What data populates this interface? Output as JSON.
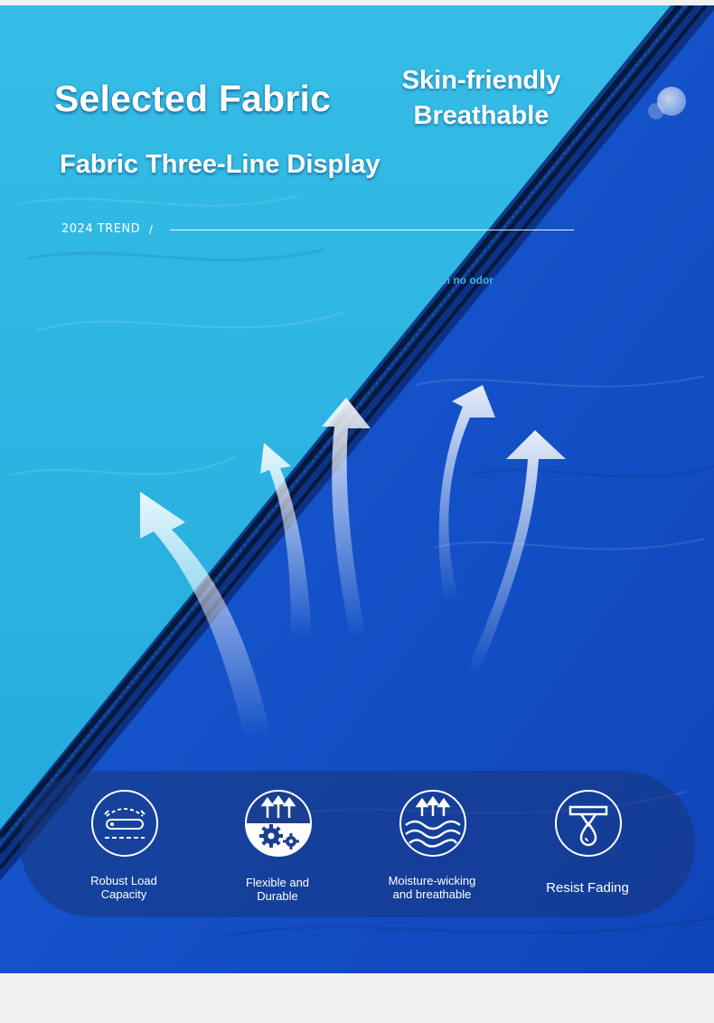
{
  "hero": {
    "title": "Selected Fabric",
    "tagline_line1": "Skin-friendly",
    "tagline_line2": "Breathable",
    "subtitle": "Fabric Three-Line Display",
    "trend": "2024 TREND",
    "trend_separator": "/",
    "description": "comfortable with no odor"
  },
  "features": [
    {
      "label_line1": "Robust Load",
      "label_line2": "Capacity",
      "icon": "rolled-hammock-icon"
    },
    {
      "label_line1": "Flexible and",
      "label_line2": "Durable",
      "icon": "gears-arrows-icon"
    },
    {
      "label_line1": "Moisture-wicking",
      "label_line2": "and breathable",
      "icon": "waves-arrows-icon"
    },
    {
      "label_line1": "Resist Fading",
      "label_line2": "",
      "icon": "drop-shield-icon"
    }
  ],
  "colors": {
    "light_fabric": "#2fb7e2",
    "dark_fabric": "#1450c8",
    "panel": "#183478",
    "text": "#ffffff"
  }
}
